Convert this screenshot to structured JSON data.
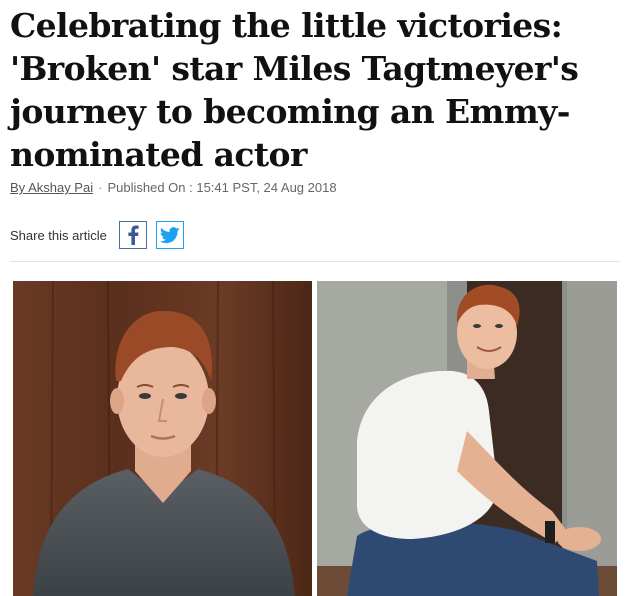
{
  "article": {
    "headline": "Celebrating the little victories: 'Broken' star Miles Tagtmeyer's journey to becoming an Emmy-nominated actor",
    "byline": "By Akshay Pai",
    "separator": "·",
    "published": "Published On : 15:41 PST, 24 Aug 2018"
  },
  "share": {
    "label": "Share this article",
    "buttons": [
      {
        "name": "facebook",
        "icon": "facebook-icon",
        "color": "#3b5998"
      },
      {
        "name": "twitter",
        "icon": "twitter-icon",
        "color": "#1da1f2"
      }
    ]
  },
  "photos": [
    {
      "subject": "portrait-dark-tshirt"
    },
    {
      "subject": "portrait-white-tshirt-seated"
    }
  ]
}
